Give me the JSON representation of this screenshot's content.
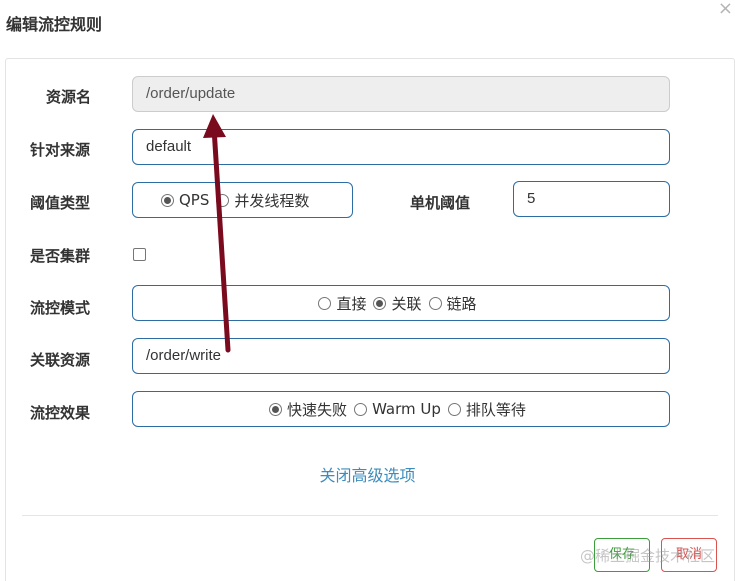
{
  "dialog": {
    "title": "编辑流控规则",
    "close_glyph": "×"
  },
  "form": {
    "resource": {
      "label": "资源名",
      "value": "/order/update"
    },
    "limit_app": {
      "label": "针对来源",
      "value": "default"
    },
    "grade": {
      "label": "阈值类型",
      "options": [
        {
          "label": "QPS",
          "selected": true
        },
        {
          "label": "并发线程数",
          "selected": false
        }
      ]
    },
    "count": {
      "label": "单机阈值",
      "value": "5"
    },
    "cluster": {
      "label": "是否集群",
      "checked": false
    },
    "strategy": {
      "label": "流控模式",
      "options": [
        {
          "label": "直接",
          "selected": false
        },
        {
          "label": "关联",
          "selected": true
        },
        {
          "label": "链路",
          "selected": false
        }
      ]
    },
    "ref_resource": {
      "label": "关联资源",
      "value": "/order/write"
    },
    "control_behavior": {
      "label": "流控效果",
      "options": [
        {
          "label": "快速失败",
          "selected": true
        },
        {
          "label": "Warm Up",
          "selected": false
        },
        {
          "label": "排队等待",
          "selected": false
        }
      ]
    },
    "advanced_toggle": "关闭高级选项"
  },
  "footer": {
    "save_label": "保存",
    "cancel_label": "取消"
  },
  "watermark": "@稀土掘金技术社区",
  "colors": {
    "primary_border": "#2e6da4",
    "link": "#3c8dbc",
    "save": "#3c9d3c",
    "cancel": "#d9534f",
    "annotation_arrow": "#7a0a1e"
  }
}
